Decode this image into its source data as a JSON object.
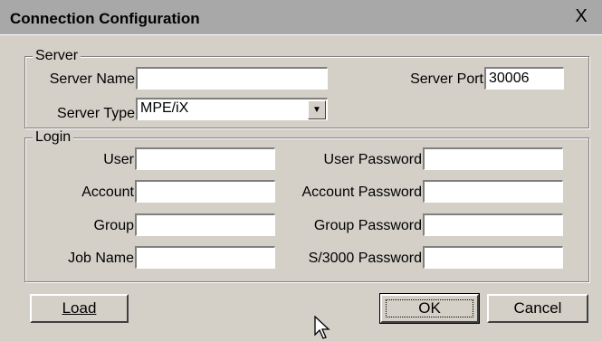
{
  "window": {
    "title": "Connection Configuration",
    "close_glyph": "X"
  },
  "server": {
    "legend": "Server",
    "name_label": "Server Name",
    "name_value": "",
    "port_label": "Server Port",
    "port_value": "30006",
    "type_label": "Server Type",
    "type_value": "MPE/iX"
  },
  "login": {
    "legend": "Login",
    "user_label": "User",
    "user_value": "",
    "account_label": "Account",
    "account_value": "",
    "group_label": "Group",
    "group_value": "",
    "jobname_label": "Job Name",
    "jobname_value": "",
    "user_password_label": "User Password",
    "account_password_label": "Account Password",
    "group_password_label": "Group Password",
    "s3000_password_label": "S/3000 Password"
  },
  "buttons": {
    "load": "Load",
    "ok": "OK",
    "cancel": "Cancel"
  },
  "icons": {
    "close": "close-icon",
    "dropdown": "dropdown-arrow-icon",
    "cursor": "mouse-pointer-icon"
  }
}
